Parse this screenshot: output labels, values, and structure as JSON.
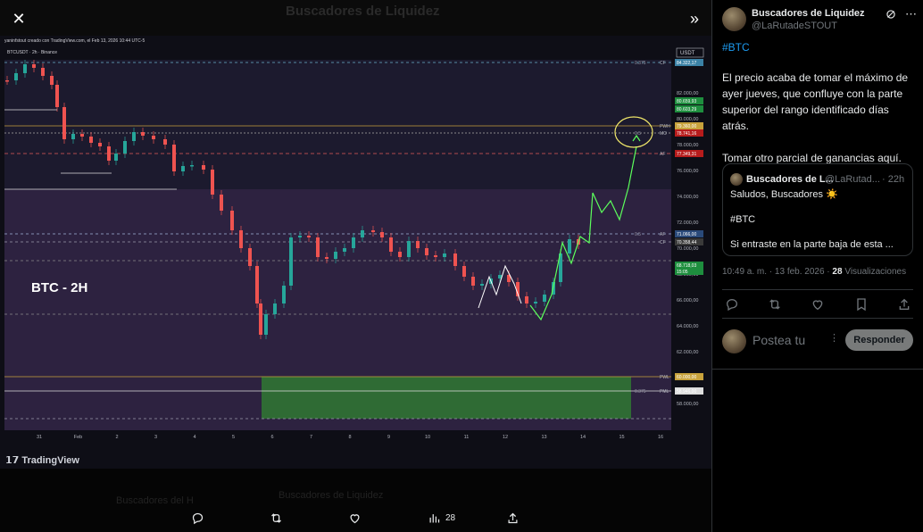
{
  "header": {
    "ghost_title": "Buscadores de Liquidez",
    "close_icon": "close-icon",
    "collapse_icon": "double-chevron-right-icon"
  },
  "chart_image": {
    "meta": "yaninfstout creado con TradingView.com, el Feb 13, 2026 10:44 UTC-5",
    "symbol": "BTCUSDT · 2h · Binance",
    "overlay_label": "BTC - 2H",
    "currency_label": "USDT",
    "brand": "TradingView",
    "price_axis": [
      "82.000,00",
      "80.000,00",
      "78.000,00",
      "76.000,00",
      "74.000,00",
      "72.000,00",
      "70.000,00",
      "68.000,00",
      "66.000,00",
      "64.000,00",
      "62.000,00",
      "60.000,00",
      "58.000,00"
    ],
    "time_axis": [
      "31",
      "Feb",
      "2",
      "3",
      "4",
      "5",
      "6",
      "7",
      "8",
      "9",
      "10",
      "11",
      "12",
      "13",
      "14",
      "15",
      "16"
    ],
    "level_tags": [
      {
        "name": "CF",
        "price": "84.322,17",
        "color": "#3b82a6",
        "fib": "0.375"
      },
      {
        "name": "",
        "price": "80.659,93",
        "color": "#1e8e3e",
        "fib": ""
      },
      {
        "name": "",
        "price": "80.603,29",
        "color": "#1e8e3e",
        "fib": ""
      },
      {
        "name": "PWH",
        "price": "79.360,00",
        "color": "#c8a23c",
        "fib": ""
      },
      {
        "name": "MO",
        "price": "78.741,16",
        "color": "#b71c1c",
        "fib": "0.5"
      },
      {
        "name": "AF",
        "price": "77.349,31",
        "color": "#b71c1c",
        "fib": ""
      },
      {
        "name": "AF",
        "price": "71.066,00",
        "color": "#2a4a7a",
        "fib": "0.5"
      },
      {
        "name": "CF",
        "price": "70.358,44",
        "color": "#3a3a3a",
        "fib": ""
      },
      {
        "name": "",
        "price": "68.718,03",
        "color": "#1e8e3e",
        "fib": ""
      },
      {
        "name": "",
        "price": "15:05",
        "color": "#1e8e3e",
        "fib": ""
      },
      {
        "name": "PWL",
        "price": "60.000,00",
        "color": "#c8a23c",
        "fib": ""
      },
      {
        "name": "PML",
        "price": "58.946,00",
        "color": "#dddddd",
        "fib": "0.375"
      }
    ]
  },
  "background_thread": {
    "row1": "Buscadores del H",
    "row2": "Buscadores de Liquidez"
  },
  "media_actions": [
    {
      "name": "reply",
      "count": ""
    },
    {
      "name": "repost",
      "count": ""
    },
    {
      "name": "like",
      "count": ""
    },
    {
      "name": "views",
      "count": "28"
    },
    {
      "name": "share",
      "count": ""
    }
  ],
  "tweet": {
    "author": "Buscadores de Liquidez",
    "handle": "@LaRutadeSTOUT",
    "hashtag": "#BTC",
    "text": "El precio acaba de tomar el máximo de ayer jueves, que confluye con la parte superior del rango identificado días atrás.\n\nTomar otro parcial de ganancias aquí.",
    "quote": {
      "author": "Buscadores de L...",
      "handle": "@LaRutad...",
      "time": "· 22h",
      "text": "Saludos, Buscadores ☀️\n\n#BTC\n\nSi entraste en la parte baja de esta ..."
    },
    "timestamp": "10:49 a. m. · 13 feb. 2026 ·",
    "views_count": "28",
    "views_label": "Visualizaciones"
  },
  "reply_box": {
    "placeholder": "Postea tu",
    "button": "Responder"
  },
  "colors": {
    "accent": "#1d9bf0",
    "muted": "#71767b",
    "divider": "#2f3336"
  }
}
